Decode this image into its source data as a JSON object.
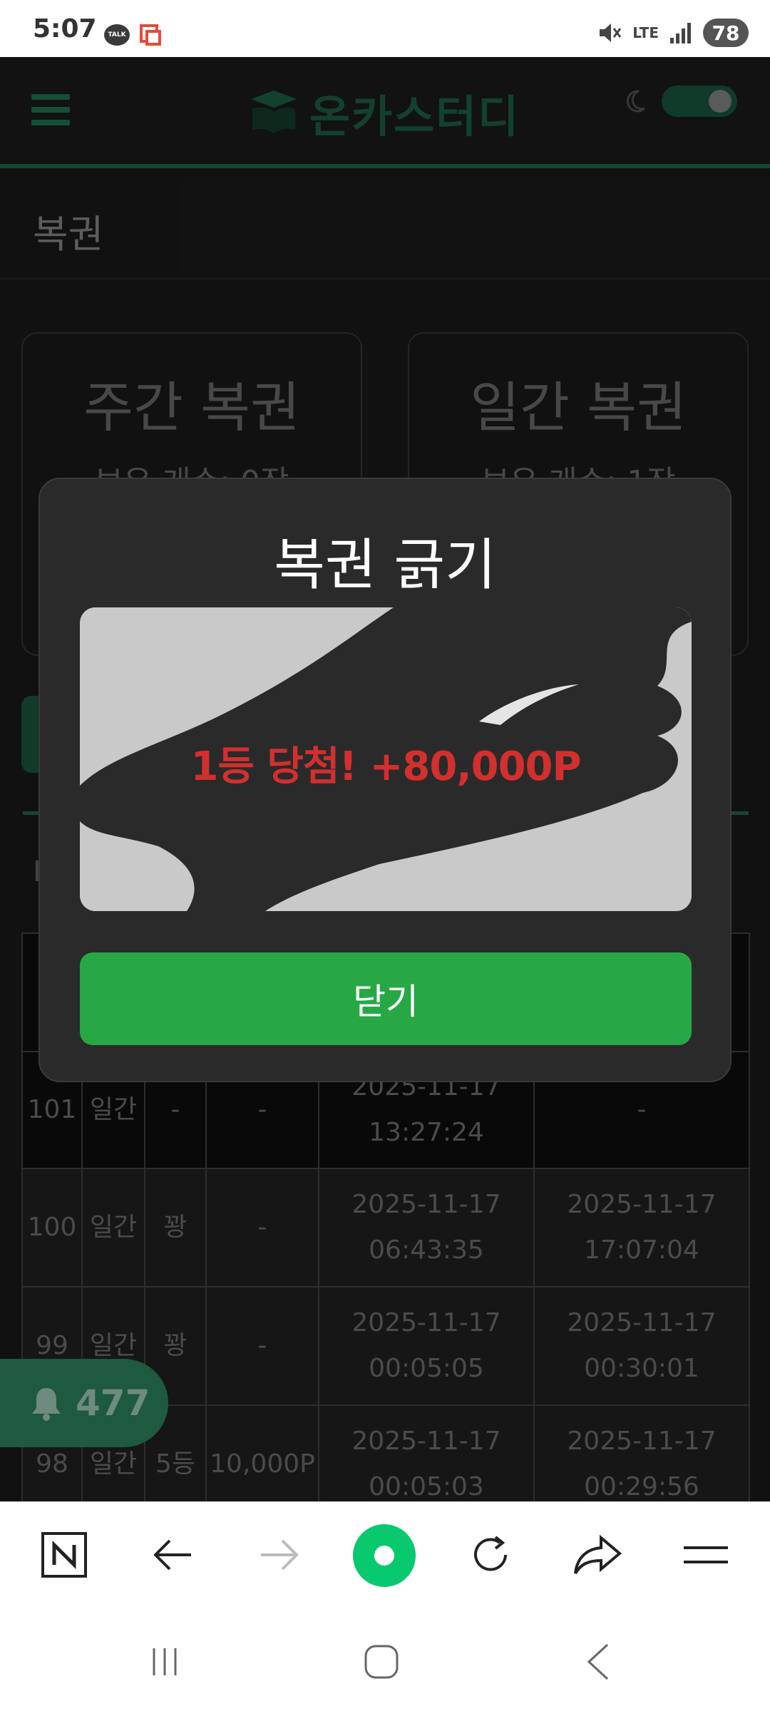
{
  "status_bar": {
    "time": "5:07",
    "talk_icon_label": "TALK",
    "network": "LTE",
    "battery": "78"
  },
  "site": {
    "logo_text": "온카스터디",
    "section_title": "복권"
  },
  "cards": [
    {
      "title": "주간 복권",
      "subtitle": "보유 개수: 0장"
    },
    {
      "title": "일간 복권",
      "subtitle": "보유 개수: 1장"
    }
  ],
  "history": {
    "rows": [
      {
        "no": "101",
        "type": "일간",
        "result": "-",
        "prize": "-",
        "issued": "2025-11-17 13:27:24",
        "scratched": "-"
      },
      {
        "no": "100",
        "type": "일간",
        "result": "꽝",
        "prize": "-",
        "issued": "2025-11-17 06:43:35",
        "scratched": "2025-11-17 17:07:04"
      },
      {
        "no": "99",
        "type": "일간",
        "result": "꽝",
        "prize": "-",
        "issued": "2025-11-17 00:05:05",
        "scratched": "2025-11-17 00:30:01"
      },
      {
        "no": "98",
        "type": "일간",
        "result": "5등",
        "prize": "10,000P",
        "issued": "2025-11-17 00:05:03",
        "scratched": "2025-11-17 00:29:56"
      }
    ]
  },
  "notification": {
    "count": "477"
  },
  "modal": {
    "title": "복권 긁기",
    "prize_text": "1등 당첨! +80,000P",
    "close_label": "닫기"
  },
  "colors": {
    "accent_green": "#27a845",
    "brand_green": "#1f6e4c",
    "prize_red": "#d32f2f",
    "page_bg": "#1b1b1b"
  }
}
